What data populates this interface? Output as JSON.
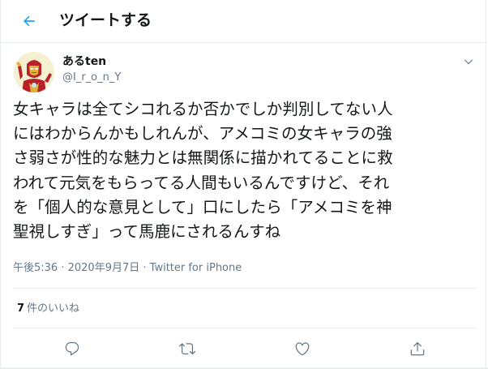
{
  "header": {
    "title": "ツイートする"
  },
  "author": {
    "display_name": "あるten",
    "handle": "@I_r_o_n_Y"
  },
  "tweet": {
    "lines": [
      "女キャラは全てシコれるか否かでしか判別してない人",
      "にはわからんかもしれんが、アメコミの女キャラの強",
      "さ弱さが性的な魅力とは無関係に描かれてることに救",
      "われて元気をもらってる人間もいるんですけど、それ",
      "を「個人的な意見として」口にしたら「アメコミを神",
      "聖視しすぎ」って馬鹿にされるんすね"
    ],
    "time": "午後5:36",
    "separator": " · ",
    "date": "2020年9月7日",
    "source": "Twitter for iPhone"
  },
  "stats": {
    "likes_count": "7",
    "likes_label": "件のいいね"
  },
  "icons": {
    "back": "arrow-left-icon",
    "caret": "chevron-down-icon",
    "reply": "reply-icon",
    "retweet": "retweet-icon",
    "like": "heart-icon",
    "share": "share-icon"
  },
  "colors": {
    "accent": "#1da1f2",
    "muted": "#657786",
    "text": "#14171a",
    "border": "#e6ecf0"
  }
}
